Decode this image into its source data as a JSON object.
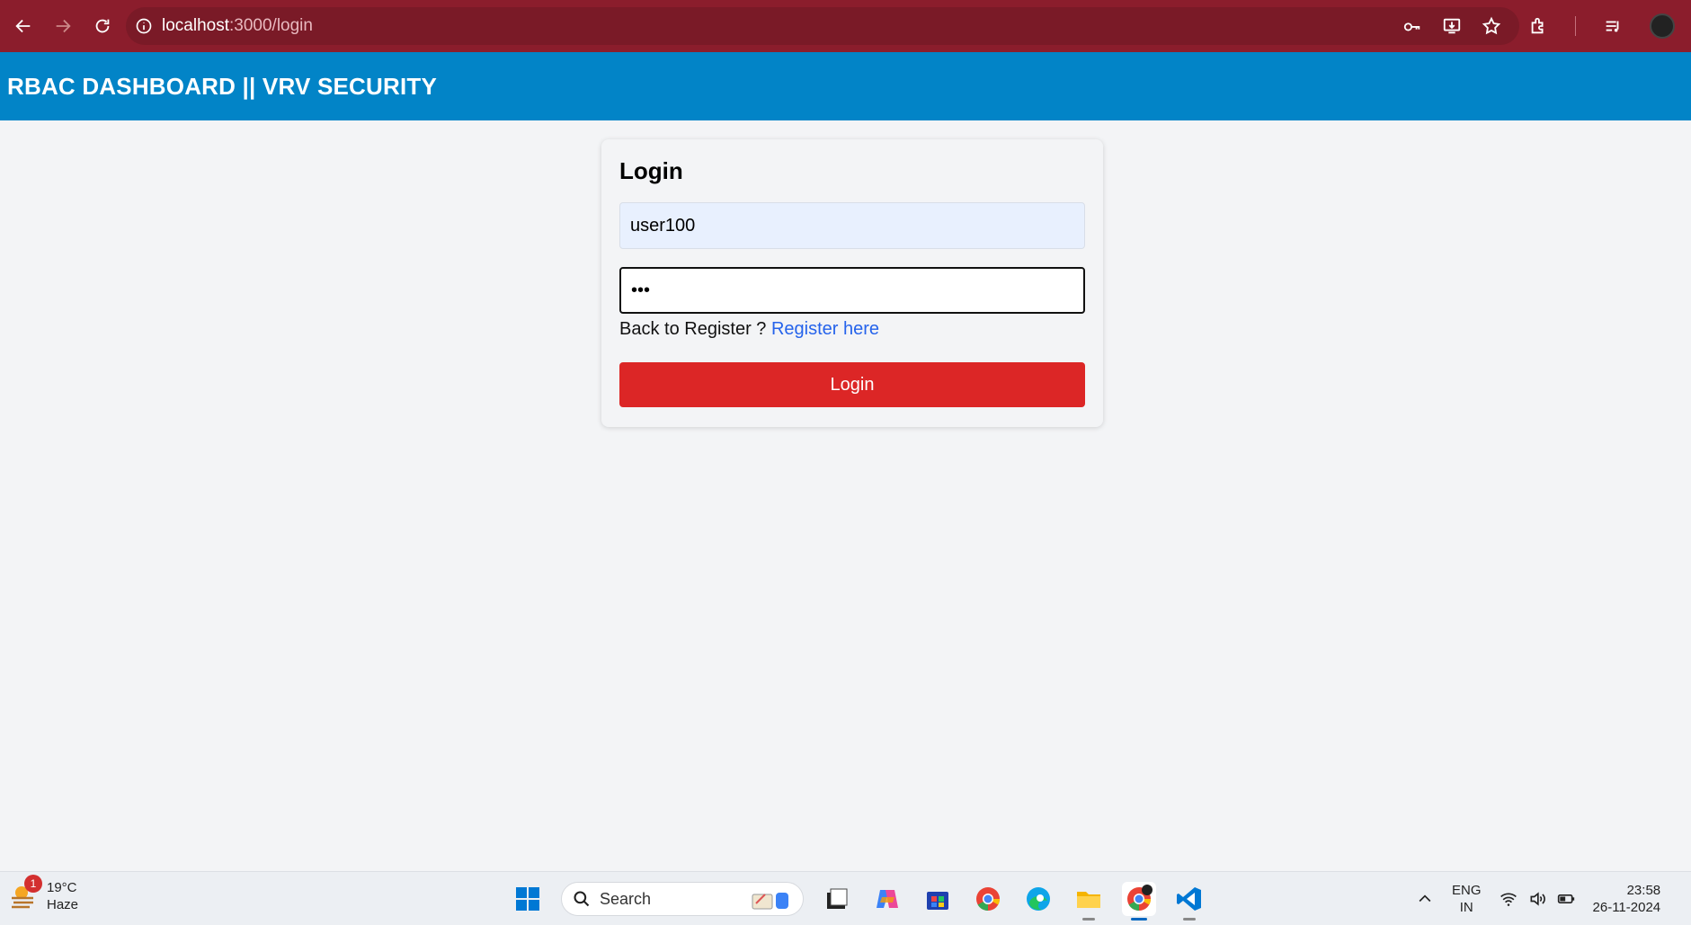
{
  "browser": {
    "url_host": "localhost",
    "url_path": ":3000/login"
  },
  "header": {
    "title": "RBAC DASHBOARD || VRV SECURITY"
  },
  "login": {
    "title": "Login",
    "username_value": "user100",
    "password_value": "•••",
    "register_prompt": "Back to Register ? ",
    "register_link": "Register here",
    "submit_label": "Login"
  },
  "colors": {
    "browser_frame": "#8b1d2c",
    "header_bg": "#0284c7",
    "button_bg": "#dc2626",
    "link": "#2563eb"
  },
  "taskbar": {
    "weather_temp": "19°C",
    "weather_desc": "Haze",
    "weather_badge": "1",
    "search_label": "Search",
    "lang_line1": "ENG",
    "lang_line2": "IN",
    "time": "23:58",
    "date": "26-11-2024",
    "apps": [
      "windows-start-icon",
      "file-manager-icon",
      "copilot-icon",
      "store-icon",
      "chrome-icon",
      "edge-icon",
      "file-explorer-icon",
      "chrome-active-icon",
      "vscode-icon"
    ]
  }
}
